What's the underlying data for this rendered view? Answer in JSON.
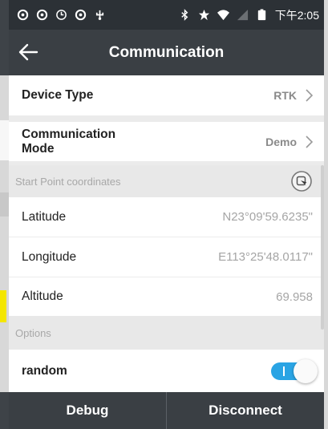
{
  "status_bar": {
    "time": "下午2:05",
    "icons": [
      "sync-icon",
      "sync-icon",
      "alarm-icon",
      "sync-icon",
      "usb-icon",
      "bluetooth-icon",
      "star-icon",
      "wifi-icon",
      "signal-icon",
      "battery-icon"
    ]
  },
  "header": {
    "title": "Communication",
    "back_icon": "arrow-left-icon"
  },
  "settings": {
    "device_type": {
      "label": "Device Type",
      "value": "RTK"
    },
    "communication_mode": {
      "label_line1": "Communication",
      "label_line2": "Mode",
      "value": "Demo"
    }
  },
  "start_point": {
    "title": "Start Point coordinates",
    "locate_icon": "locate-icon",
    "latitude": {
      "label": "Latitude",
      "value": "N23°09'59.6235\""
    },
    "longitude": {
      "label": "Longitude",
      "value": "E113°25'48.0117\""
    },
    "altitude": {
      "label": "Altitude",
      "value": "69.958"
    }
  },
  "options": {
    "title": "Options",
    "random": {
      "label": "random",
      "enabled": true
    }
  },
  "footer": {
    "debug_label": "Debug",
    "disconnect_label": "Disconnect"
  },
  "colors": {
    "header_bg": "#3a3f44",
    "status_bg": "#2c3136",
    "toggle_on": "#2aa4e4"
  }
}
